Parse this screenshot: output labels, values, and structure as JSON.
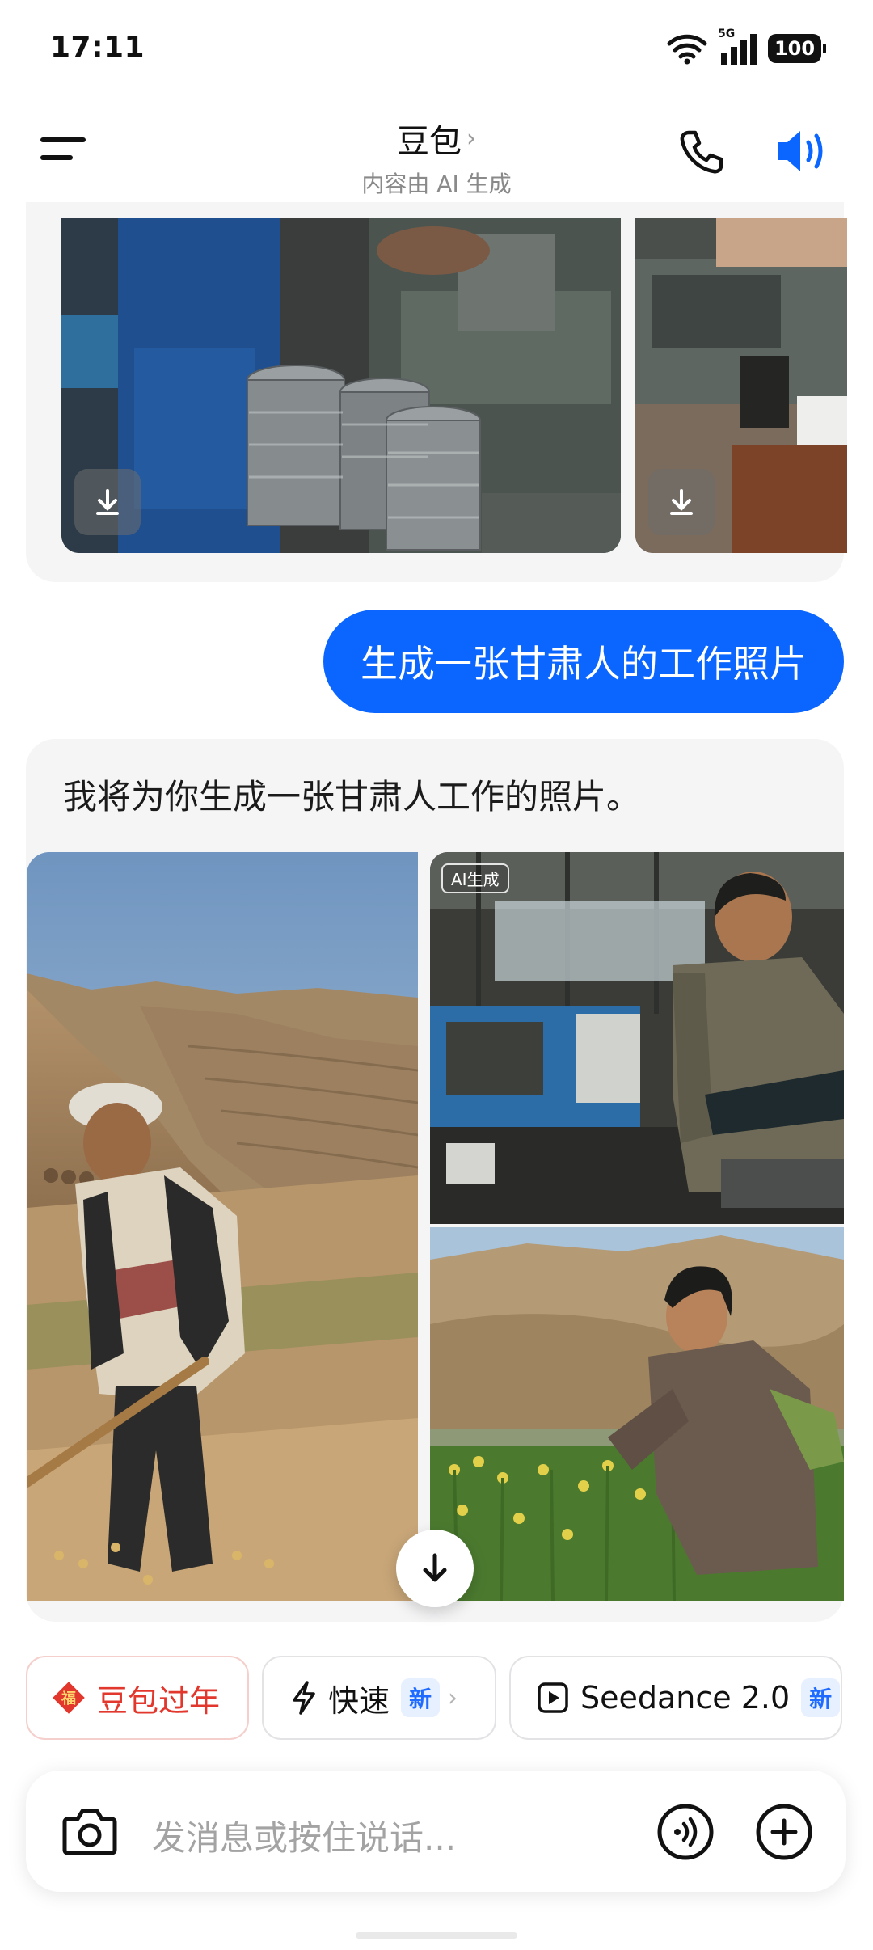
{
  "status_bar": {
    "time": "17:11",
    "network": "5G",
    "battery": "100"
  },
  "header": {
    "title": "豆包",
    "title_chevron": "›",
    "subtitle": "内容由 AI 生成",
    "icons": [
      "menu-icon",
      "phone-icon",
      "speaker-icon"
    ],
    "accent_color": "#0a66ff"
  },
  "chat": {
    "user_message": "生成一张甘肃人的工作照片",
    "bot_message": "我将为你生成一张甘肃人工作的照片。",
    "ai_tag": "AI生成"
  },
  "chips": [
    {
      "label": "豆包过年",
      "icon": "fu-icon",
      "color": "#e2372c"
    },
    {
      "label": "快速",
      "icon": "bolt-icon",
      "badge": "新",
      "arrow": "›"
    },
    {
      "label": "Seedance 2.0",
      "icon": "play-square-icon",
      "badge": "新"
    }
  ],
  "input": {
    "placeholder": "发消息或按住说话..."
  }
}
